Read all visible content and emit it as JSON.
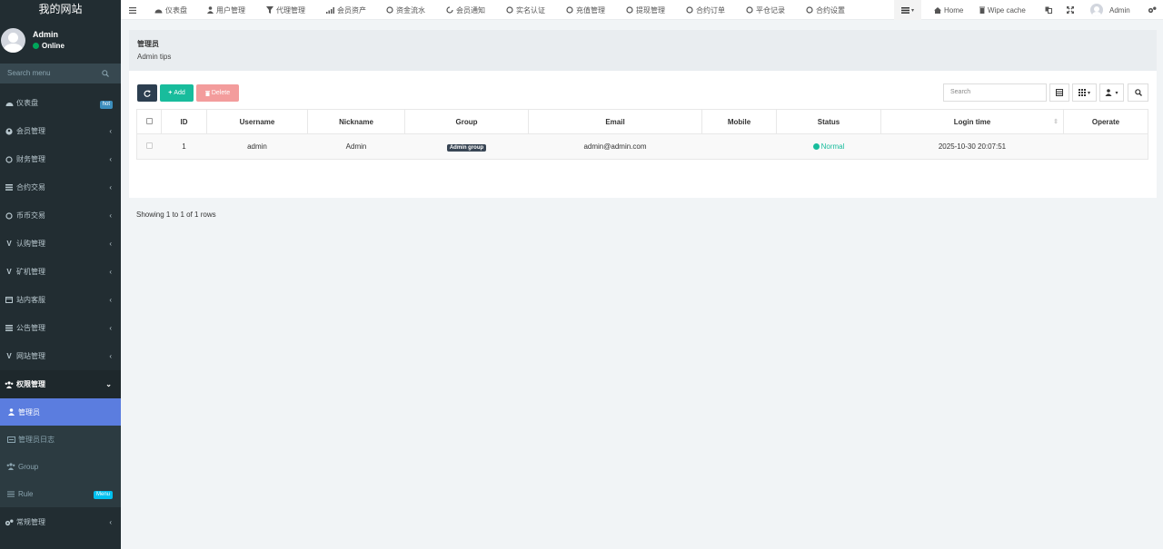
{
  "brand": "我的网站",
  "user": {
    "name": "Admin",
    "status": "Online"
  },
  "search_placeholder": "Search menu",
  "sidebar": {
    "items": [
      {
        "label": "仪表盘",
        "icon": "dashboard-icon",
        "badge": "hot",
        "badge_color": "#3c8dbc"
      },
      {
        "label": "会员管理",
        "icon": "user-circle-icon"
      },
      {
        "label": "财务管理",
        "icon": "circle-icon"
      },
      {
        "label": "合约交易",
        "icon": "list-icon"
      },
      {
        "label": "币币交易",
        "icon": "circle-icon"
      },
      {
        "label": "认购管理",
        "icon": "vimeo-icon"
      },
      {
        "label": "矿机管理",
        "icon": "vimeo-icon"
      },
      {
        "label": "站内客服",
        "icon": "window-icon"
      },
      {
        "label": "公告管理",
        "icon": "list-icon"
      },
      {
        "label": "网站管理",
        "icon": "vimeo-icon"
      },
      {
        "label": "权限管理",
        "icon": "group-icon"
      }
    ],
    "subitems": [
      {
        "label": "管理员",
        "icon": "user-icon"
      },
      {
        "label": "管理员日志",
        "icon": "list-icon"
      },
      {
        "label": "Group",
        "icon": "group-icon"
      },
      {
        "label": "Rule",
        "icon": "bars-icon",
        "badge": "Menu",
        "badge_color": "#00c0ef"
      }
    ],
    "last": {
      "label": "常规管理",
      "icon": "cogs-icon"
    }
  },
  "topnav": {
    "items": [
      {
        "label": "仪表盘",
        "icon": "dashboard-icon"
      },
      {
        "label": "用户管理",
        "icon": "user-icon"
      },
      {
        "label": "代理管理",
        "icon": "filter-icon"
      },
      {
        "label": "会员资产",
        "icon": "signal-icon"
      },
      {
        "label": "资金流水",
        "icon": "circle-icon"
      },
      {
        "label": "会员通知",
        "icon": "circle-notch-icon"
      },
      {
        "label": "实名认证",
        "icon": "circle-icon"
      },
      {
        "label": "充值管理",
        "icon": "circle-icon"
      },
      {
        "label": "提现管理",
        "icon": "circle-icon"
      },
      {
        "label": "合约订单",
        "icon": "circle-icon"
      },
      {
        "label": "平仓记录",
        "icon": "circle-icon"
      },
      {
        "label": "合约设置",
        "icon": "circle-icon"
      }
    ],
    "home": "Home",
    "wipe": "Wipe cache",
    "admin": "Admin"
  },
  "page": {
    "title": "管理员",
    "tips": "Admin tips"
  },
  "toolbar": {
    "add": "Add",
    "delete": "Delete",
    "search_placeholder": "Search"
  },
  "table": {
    "headers": [
      "ID",
      "Username",
      "Nickname",
      "Group",
      "Email",
      "Mobile",
      "Status",
      "Login time",
      "Operate"
    ],
    "rows": [
      {
        "id": "1",
        "username": "admin",
        "nickname": "Admin",
        "group": "Admin group",
        "email": "admin@admin.com",
        "mobile": "",
        "status": "Normal",
        "login_time": "2025-10-30 20:07:51"
      }
    ]
  },
  "pager": "Showing 1 to 1 of 1 rows",
  "colors": {
    "sidebar_bg": "#222d32",
    "active": "#5b7ddf",
    "add": "#18bc9c",
    "delete": "#f39c9c",
    "refresh": "#2c3e50"
  }
}
